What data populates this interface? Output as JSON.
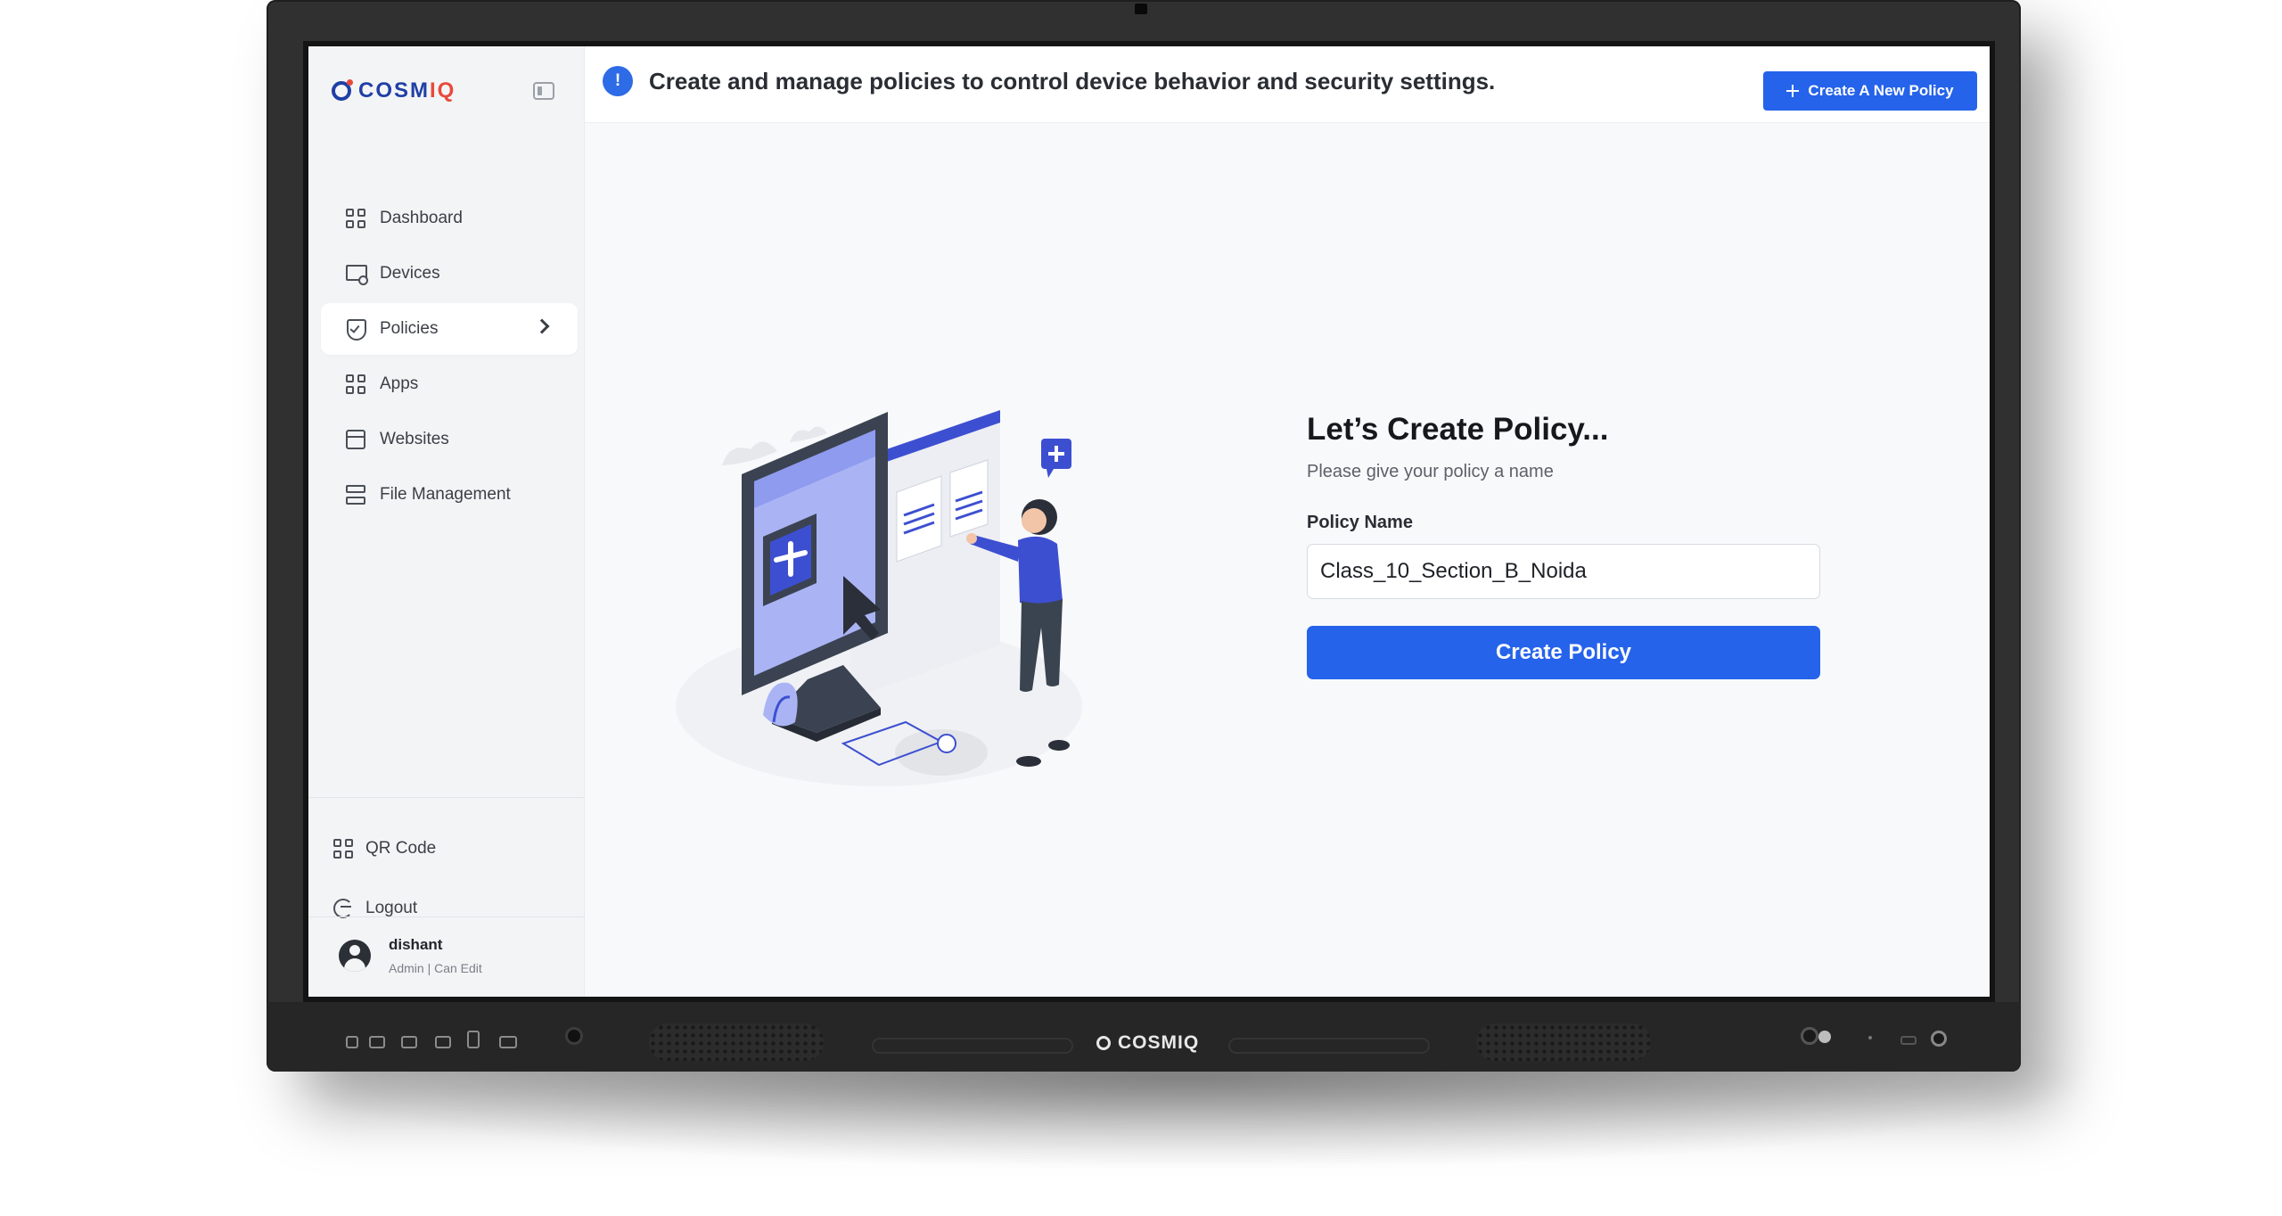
{
  "brand": {
    "name_main": "COSM",
    "name_accent": "IQ",
    "bottom_logo": "COSMIQ"
  },
  "header": {
    "info_text": "Create and manage policies to control device behavior and security settings.",
    "info_icon": "!",
    "create_button": "Create A New Policy"
  },
  "sidebar": {
    "items": [
      {
        "label": "Dashboard",
        "icon": "grid-icon"
      },
      {
        "label": "Devices",
        "icon": "monitor-icon"
      },
      {
        "label": "Policies",
        "icon": "shield-icon",
        "active": true
      },
      {
        "label": "Apps",
        "icon": "grid-icon"
      },
      {
        "label": "Websites",
        "icon": "window-icon"
      },
      {
        "label": "File Management",
        "icon": "file-icon"
      }
    ],
    "bottom": [
      {
        "label": "QR Code",
        "icon": "grid-icon"
      },
      {
        "label": "Logout",
        "icon": "logout-icon"
      }
    ],
    "user": {
      "name": "dishant",
      "role": "Admin | Can Edit"
    }
  },
  "form": {
    "title": "Let’s Create Policy...",
    "subtitle": "Please give your policy a name",
    "field_label": "Policy Name",
    "field_value": "Class_10_Section_B_Noida",
    "submit_label": "Create Policy"
  },
  "colors": {
    "primary": "#2563eb",
    "brand_blue": "#1f3fa6",
    "brand_red": "#e8493b"
  }
}
